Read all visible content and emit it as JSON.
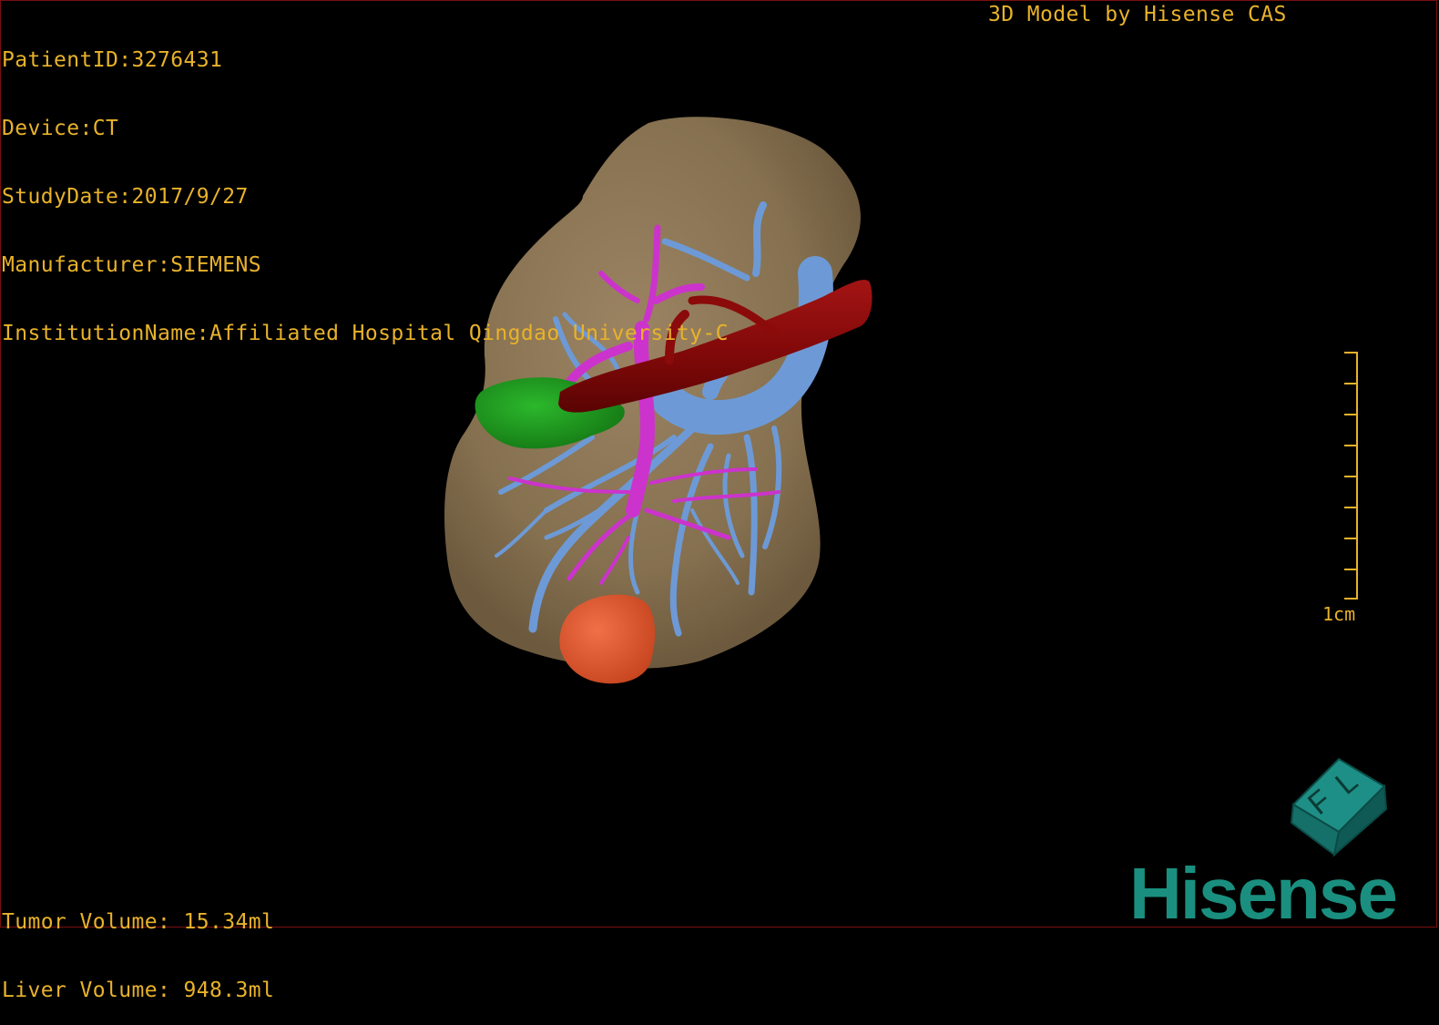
{
  "header": {
    "patient_id": "PatientID:3276431",
    "device": "Device:CT",
    "study_date": "StudyDate:2017/9/27",
    "manufacturer": "Manufacturer:SIEMENS",
    "institution": "InstitutionName:Affiliated Hospital Qingdao University-C",
    "brand": "3D Model by Hisense CAS"
  },
  "volumes": {
    "tumor": "Tumor Volume: 15.34ml",
    "liver": "Liver Volume: 948.3ml"
  },
  "scale_bar": {
    "label": "1cm"
  },
  "orientation_cube": {
    "faces": [
      "F",
      "L"
    ]
  },
  "logo": {
    "text": "Hisense"
  },
  "colors": {
    "overlay_text": "#e8b22a",
    "liver": "#8b7558",
    "portal_vein": "#6d9ad6",
    "hepatic_artery": "#cc33cc",
    "ivc": "#8b0a0a",
    "gallbladder": "#22a022",
    "tumor": "#e05a2e",
    "logo": "#1a8f7f"
  }
}
